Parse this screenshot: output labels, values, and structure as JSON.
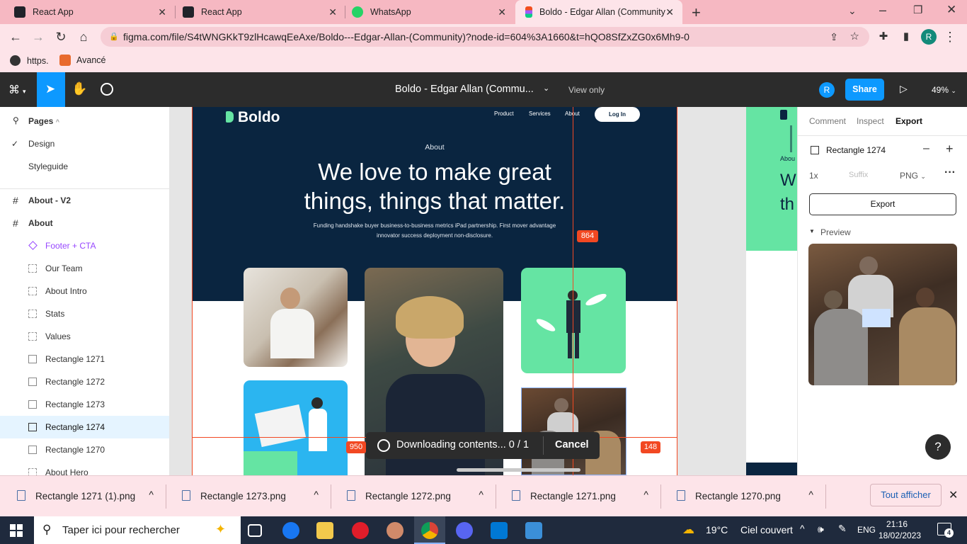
{
  "browser": {
    "tabs": [
      {
        "title": "React App",
        "icon": "react-icon"
      },
      {
        "title": "React App",
        "icon": "react-icon"
      },
      {
        "title": "WhatsApp",
        "icon": "whatsapp-icon"
      },
      {
        "title": "Boldo - Edgar Allan (Community)",
        "icon": "figma-icon",
        "active": true
      }
    ],
    "url": "figma.com/file/S4tWNGKkT9zlHcawqEeAxe/Boldo---Edgar-Allan-(Community)?node-id=604%3A1660&t=hQO8SfZxZG0x6Mh9-0",
    "profile_initial": "R",
    "bookmarks": [
      {
        "label": "https.",
        "icon": "globe-icon"
      },
      {
        "label": "Avancé",
        "icon": "avance-icon"
      }
    ]
  },
  "figma": {
    "file_title": "Boldo - Edgar Allan (Commu...",
    "view_mode": "View only",
    "user_initial": "R",
    "share_label": "Share",
    "zoom": "49%",
    "left": {
      "pages_label": "Pages",
      "pages": [
        {
          "label": "Design",
          "selected": true
        },
        {
          "label": "Styleguide",
          "selected": false
        }
      ],
      "frames": [
        {
          "label": "About - V2",
          "type": "frame"
        },
        {
          "label": "About",
          "type": "frame"
        }
      ],
      "layers": [
        {
          "label": "Footer + CTA",
          "type": "component"
        },
        {
          "label": "Our Team",
          "type": "section"
        },
        {
          "label": "About Intro",
          "type": "section"
        },
        {
          "label": "Stats",
          "type": "section"
        },
        {
          "label": "Values",
          "type": "section"
        },
        {
          "label": "Rectangle 1271",
          "type": "image"
        },
        {
          "label": "Rectangle 1272",
          "type": "image"
        },
        {
          "label": "Rectangle 1273",
          "type": "image"
        },
        {
          "label": "Rectangle 1274",
          "type": "image",
          "selected": true
        },
        {
          "label": "Rectangle 1270",
          "type": "image"
        },
        {
          "label": "About Hero",
          "type": "section"
        }
      ]
    },
    "canvas": {
      "site": {
        "logo": "Boldo",
        "nav": [
          "Product",
          "Services",
          "About"
        ],
        "login": "Log In",
        "eyebrow": "About",
        "headline_1": "We love to make great",
        "headline_2": "things, things that matter.",
        "sub_1": "Funding handshake buyer business-to-business metrics iPad partnership. First mover advantage",
        "sub_2": "innovator success deployment non-disclosure."
      },
      "measure_864": "864",
      "measure_950": "950",
      "measure_148": "148",
      "download_status": "Downloading contents... 0 / 1",
      "cancel_label": "Cancel",
      "right_frame_text_1": "W",
      "right_frame_text_2": "th",
      "right_frame_text_3": "Abou"
    },
    "right": {
      "tabs": [
        "Comment",
        "Inspect",
        "Export"
      ],
      "active_tab": "Export",
      "layer_name": "Rectangle 1274",
      "scale": "1x",
      "suffix_placeholder": "Suffix",
      "format": "PNG",
      "export_button": "Export",
      "preview_label": "Preview",
      "help": "?"
    }
  },
  "downloads": {
    "items": [
      "Rectangle 1271 (1).png",
      "Rectangle 1273.png",
      "Rectangle 1272.png",
      "Rectangle 1271.png",
      "Rectangle 1270.png"
    ],
    "show_all": "Tout afficher"
  },
  "taskbar": {
    "search_placeholder": "Taper ici pour rechercher",
    "weather_temp": "19°C",
    "weather_desc": "Ciel couvert",
    "language": "ENG",
    "time": "21:16",
    "date": "18/02/2023",
    "notifications": "4"
  },
  "colors": {
    "accent_blue": "#0d99ff",
    "site_navy": "#0a2540",
    "site_green": "#65e4a3",
    "site_sky": "#2bb5f0",
    "measure_red": "#f24822",
    "tab_pink": "#f6b8c2"
  }
}
